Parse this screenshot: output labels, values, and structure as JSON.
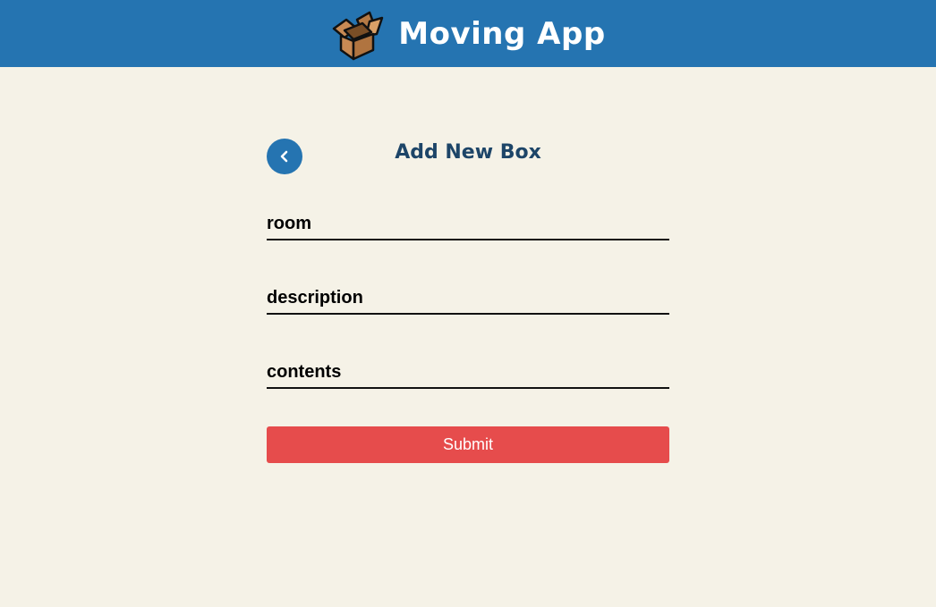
{
  "header": {
    "title": "Moving App",
    "logo_icon": "cardboard-box-icon",
    "background_color": "#2574b1"
  },
  "page": {
    "title": "Add New Box",
    "back_icon": "chevron-left-icon",
    "title_color": "#1d4568",
    "background_color": "#f5f2e7"
  },
  "form": {
    "room": {
      "placeholder": "room",
      "value": ""
    },
    "description": {
      "placeholder": "description",
      "value": ""
    },
    "contents": {
      "placeholder": "contents",
      "value": ""
    },
    "submit_label": "Submit",
    "submit_color": "#e64c4c"
  }
}
